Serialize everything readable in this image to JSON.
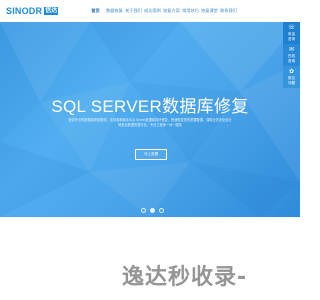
{
  "header": {
    "logo_text": "SINODR",
    "logo_cn": "信达",
    "nav": [
      "首页",
      "数据恢复",
      "关于我们",
      "成功案例",
      "恢复方案",
      "常用技巧",
      "恢复课堂",
      "联系我们"
    ]
  },
  "hero": {
    "title": "SQL SERVER数据库修复",
    "desc_line1": "提供专业的数据库修复服务，支持各种版本SQL Server数据库损坏修复，快速恢复您的重要数据，保障业务安全运行",
    "desc_line2": "修复后数据完整可靠，专业工程师一对一服务",
    "button_label": "马上查看",
    "slides": 3,
    "active_slide": 1
  },
  "side": {
    "items": [
      {
        "icon": "☏",
        "label": "电话\n咨询"
      },
      {
        "icon": "✉",
        "label": "在线\n咨询"
      },
      {
        "icon": "✿",
        "label": "常见\n问题"
      }
    ]
  },
  "watermark": "逸达秒收录-"
}
